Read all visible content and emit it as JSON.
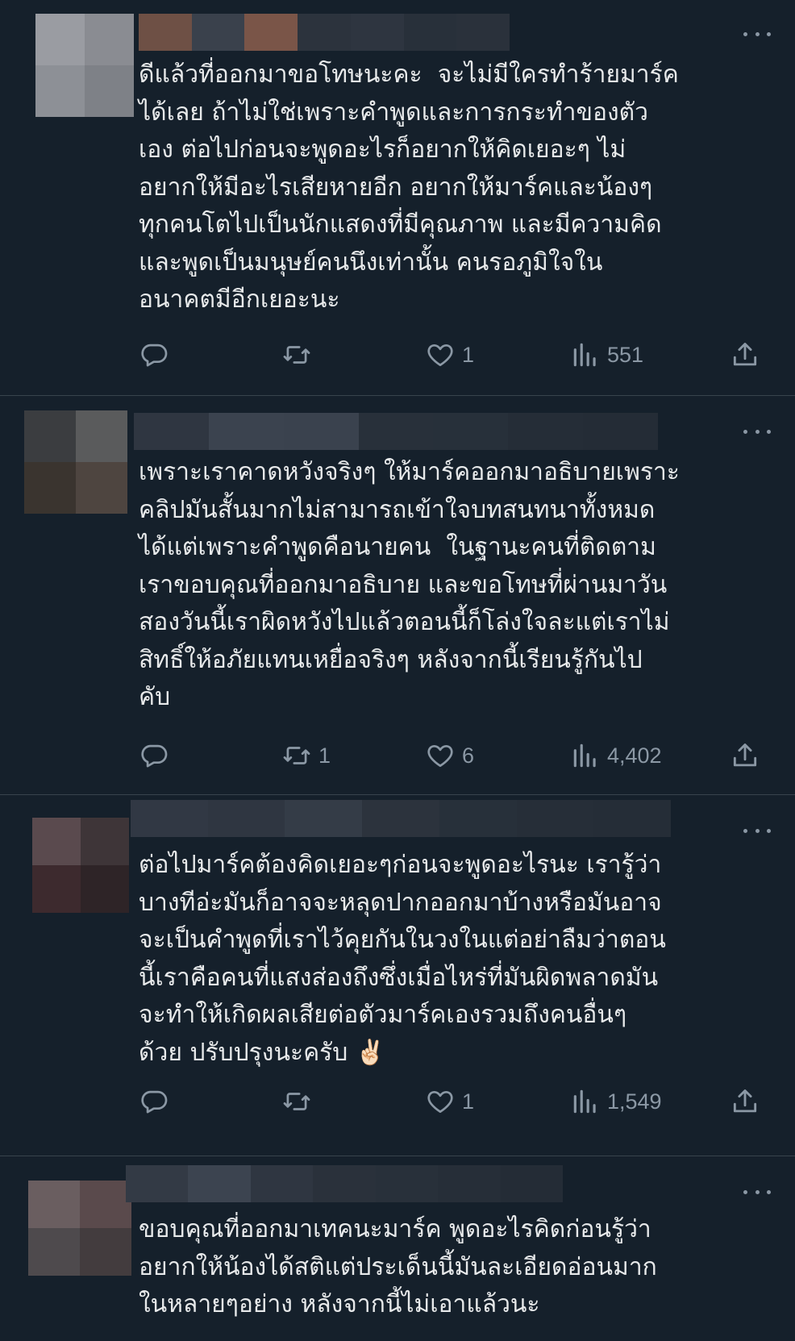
{
  "replies": [
    {
      "text": "ดีแล้วที่ออกมาขอโทษนะคะ  จะไม่มีใครทำร้ายมาร์ค\nได้เลย ถ้าไม่ใช่เพราะคำพูดและการกระทำของตัว\nเอง ต่อไปก่อนจะพูดอะไรก็อยากให้คิดเยอะๆ ไม่\nอยากให้มีอะไรเสียหายอีก อยากให้มาร์คและน้องๆ\nทุกคนโตไปเป็นนักแสดงที่มีคุณภาพ และมีความคิด\nและพูดเป็นมนุษย์คนนึงเท่านั้น คนรอภูมิใจใน\nอนาคตมีอีกเยอะนะ",
      "replies": "",
      "retweets": "",
      "likes": "1",
      "views": "551",
      "avatar_colors": [
        "#9a9ca2",
        "#8a8c92",
        "#8d9096",
        "#7e8187"
      ],
      "name_colors": [
        "#6e5045",
        "#3a414c",
        "#7a5548",
        "#2c333d",
        "#2e3540",
        "#28303a",
        "#2a313b"
      ]
    },
    {
      "text": "เพราะเราคาดหวังจริงๆ ให้มาร์คออกมาอธิบายเพราะ\nคลิปมันสั้นมากไม่สามารถเข้าใจบทสนทนาทั้งหมด\nได้แต่เพราะคำพูดคือนายคน  ในฐานะคนที่ติดตาม\nเราขอบคุณที่ออกมาอธิบาย และขอโทษที่ผ่านมาวัน\nสองวันนี้เราผิดหวังไปแล้วตอนนี้ก็โล่งใจละแต่เราไม่\nสิทธิ์ให้อภัยแทนเหยื่อจริงๆ หลังจากนี้เรียนรู้กันไป\nคับ",
      "replies": "",
      "retweets": "1",
      "likes": "6",
      "views": "4,402",
      "avatar_colors": [
        "#3b3d40",
        "#5a5b5c",
        "#3a342f",
        "#4e4540"
      ],
      "name_colors": [
        "#2f3641",
        "#3b434f",
        "#3a424e",
        "#28303a",
        "#27303a",
        "#252d37",
        "#242c36"
      ]
    },
    {
      "text": "ต่อไปมาร์คต้องคิดเยอะๆก่อนจะพูดอะไรนะ เรารู้ว่า\nบางทีอ่ะมันก็อาจจะหลุดปากออกมาบ้างหรือมันอาจ\nจะเป็นคำพูดที่เราไว้คุยกันในวงในแต่อย่าลืมว่าตอน\nนี้เราคือคนที่แสงส่องถึงซึ่งเมื่อไหร่ที่มันผิดพลาดมัน\nจะทำให้เกิดผลเสียต่อตัวมาร์คเองรวมถึงคนอื่นๆ\nด้วย ปรับปรุงนะครับ ✌🏻",
      "replies": "",
      "retweets": "",
      "likes": "1",
      "views": "1,549",
      "avatar_colors": [
        "#5a4a4e",
        "#3e3538",
        "#3d2a2e",
        "#2e2427"
      ],
      "name_colors": [
        "#313844",
        "#2f3641",
        "#343c47",
        "#2c333d",
        "#27303a",
        "#262e38",
        "#252d37"
      ]
    },
    {
      "text": "ขอบคุณที่ออกมาเทคนะมาร์ค พูดอะไรคิดก่อนรู้ว่า\nอยากให้น้องได้สติแต่ประเด็นนี้มันละเอียดอ่อนมาก\nในหลายๆอย่าง หลังจากนี้ไม่เอาแล้วนะ",
      "avatar_colors": [
        "#6a5e60",
        "#5a4a4c",
        "#4e4a4d",
        "#433c3e"
      ],
      "name_colors": [
        "#333a45",
        "#3c4450",
        "#2f3641",
        "#2a313b",
        "#28303a",
        "#262e38",
        "#242c36"
      ]
    }
  ],
  "icons": {
    "reply": "reply-icon",
    "retweet": "retweet-icon",
    "like": "heart-icon",
    "views": "views-icon",
    "share": "share-icon",
    "more": "more-icon"
  }
}
